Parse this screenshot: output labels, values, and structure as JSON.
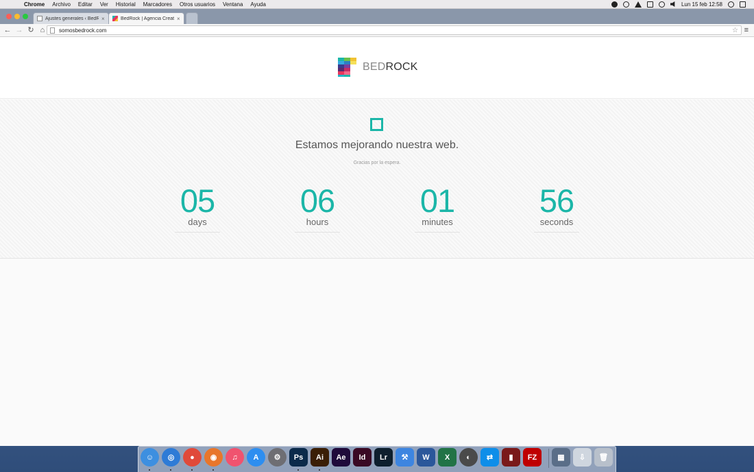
{
  "menubar": {
    "app_name": "Chrome",
    "items": [
      "Archivo",
      "Editar",
      "Ver",
      "Historial",
      "Marcadores",
      "Otros usuarios",
      "Ventana",
      "Ayuda"
    ],
    "datetime": "Lun 15 feb  12:58"
  },
  "browser": {
    "tabs": [
      {
        "title": "Ajustes generales ‹ BedRo",
        "active": false
      },
      {
        "title": "BedRock | Agencia Creati",
        "active": true
      }
    ],
    "url": "somosbedrock.com"
  },
  "site": {
    "logo_light": "BED",
    "logo_bold": "ROCK",
    "headline": "Estamos mejorando nuestra web.",
    "subheadline": "Gracias por la espera.",
    "accent_color": "#1bb6a8",
    "countdown": [
      {
        "value": "05",
        "label": "days"
      },
      {
        "value": "06",
        "label": "hours"
      },
      {
        "value": "01",
        "label": "minutes"
      },
      {
        "value": "56",
        "label": "seconds"
      }
    ]
  },
  "dock": {
    "apps": [
      {
        "name": "finder-icon",
        "glyph": "☺"
      },
      {
        "name": "safari-icon",
        "glyph": "◎"
      },
      {
        "name": "chrome-icon",
        "glyph": "●"
      },
      {
        "name": "firefox-icon",
        "glyph": "◉"
      },
      {
        "name": "itunes-icon",
        "glyph": "♫"
      },
      {
        "name": "app-store-icon",
        "glyph": "A"
      },
      {
        "name": "system-preferences-icon",
        "glyph": "⚙"
      },
      {
        "name": "photoshop-icon",
        "glyph": "Ps"
      },
      {
        "name": "illustrator-icon",
        "glyph": "Ai"
      },
      {
        "name": "after-effects-icon",
        "glyph": "Ae"
      },
      {
        "name": "indesign-icon",
        "glyph": "Id"
      },
      {
        "name": "lightroom-icon",
        "glyph": "Lr"
      },
      {
        "name": "xcode-icon",
        "glyph": "⚒"
      },
      {
        "name": "word-icon",
        "glyph": "W"
      },
      {
        "name": "excel-icon",
        "glyph": "X"
      },
      {
        "name": "disk-utility-icon",
        "glyph": "◐"
      },
      {
        "name": "teamviewer-icon",
        "glyph": "⇄"
      },
      {
        "name": "battery-app-icon",
        "glyph": "▮"
      },
      {
        "name": "filezilla-icon",
        "glyph": "FZ"
      },
      {
        "name": "preview-icon",
        "glyph": "▦"
      },
      {
        "name": "downloads-icon",
        "glyph": "⇩"
      },
      {
        "name": "trash-icon",
        "glyph": "🗑"
      }
    ]
  }
}
